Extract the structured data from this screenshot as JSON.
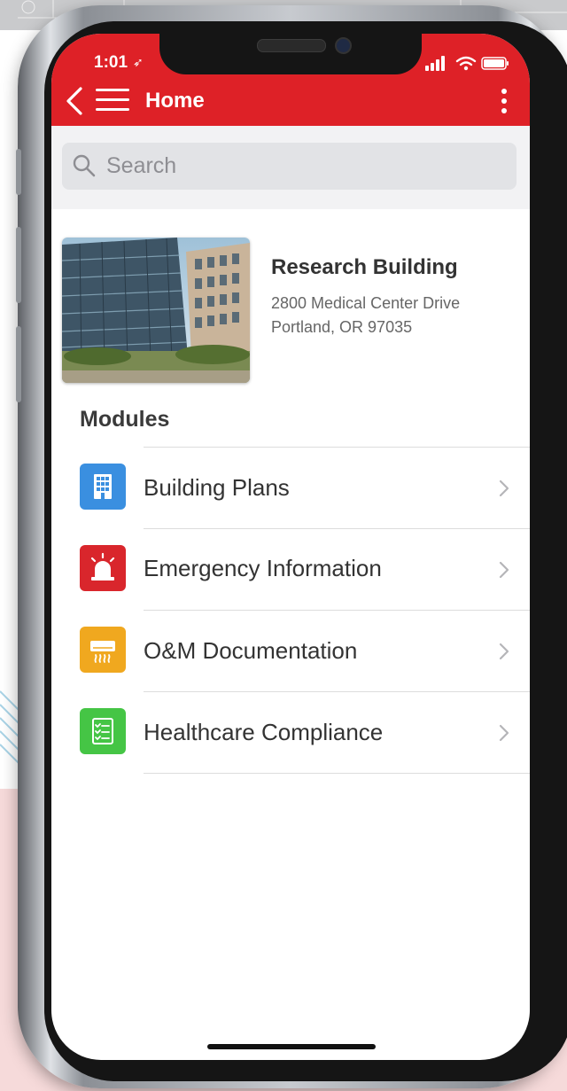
{
  "status_bar": {
    "time": "1:01",
    "location_glyph": "➶"
  },
  "header": {
    "title": "Home"
  },
  "search": {
    "placeholder": "Search"
  },
  "building": {
    "name": "Research Building",
    "address_line1": "2800 Medical Center Drive",
    "address_line2": "Portland, OR 97035"
  },
  "modules": {
    "heading": "Modules",
    "items": [
      {
        "label": "Building Plans",
        "icon": "building-icon",
        "color": "#3a8fe0"
      },
      {
        "label": "Emergency Information",
        "icon": "alarm-icon",
        "color": "#d9262c"
      },
      {
        "label": "O&M Documentation",
        "icon": "air-conditioner-icon",
        "color": "#f0a81f"
      },
      {
        "label": "Healthcare Compliance",
        "icon": "checklist-icon",
        "color": "#45c545"
      }
    ]
  },
  "colors": {
    "accent": "#de2127",
    "search_bg": "#f2f2f4"
  }
}
